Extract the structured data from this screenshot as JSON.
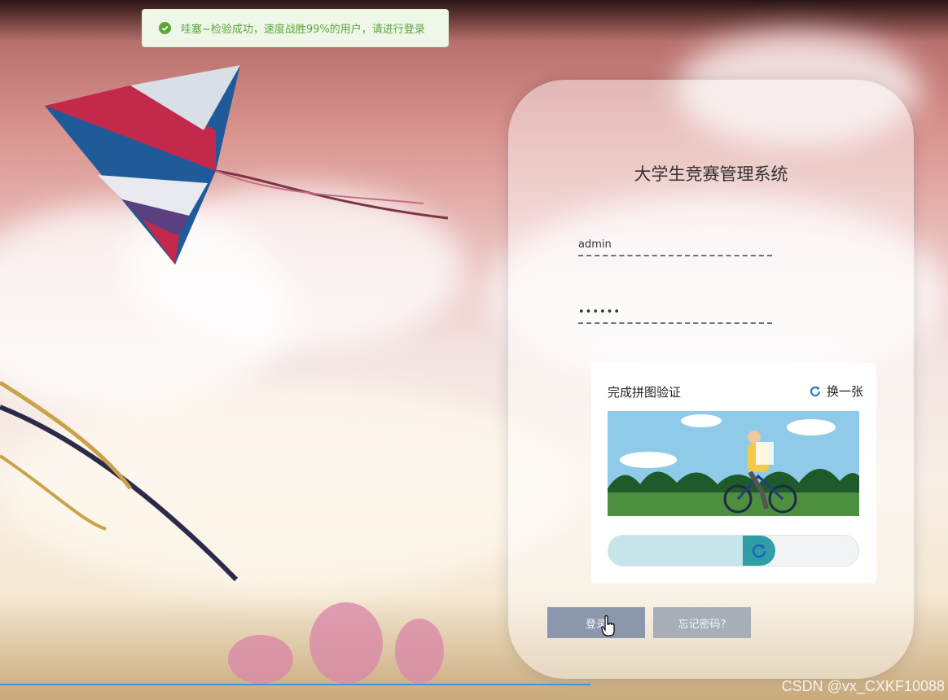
{
  "toast": {
    "icon": "check-circle-icon",
    "message": "哇塞~检验成功，速度战胜99%的用户，请进行登录",
    "color": "#5aa63a"
  },
  "login": {
    "title": "大学生竞赛管理系统",
    "username_value": "admin",
    "password_value": "••••••",
    "login_button": "登录",
    "forgot_button": "忘记密码?"
  },
  "captcha": {
    "title": "完成拼图验证",
    "refresh_label": "换一张",
    "refresh_icon": "refresh-icon",
    "slider_progress": 0.54,
    "accent": "#2f9ea6"
  },
  "watermark": "CSDN @vx_CXKF10088"
}
